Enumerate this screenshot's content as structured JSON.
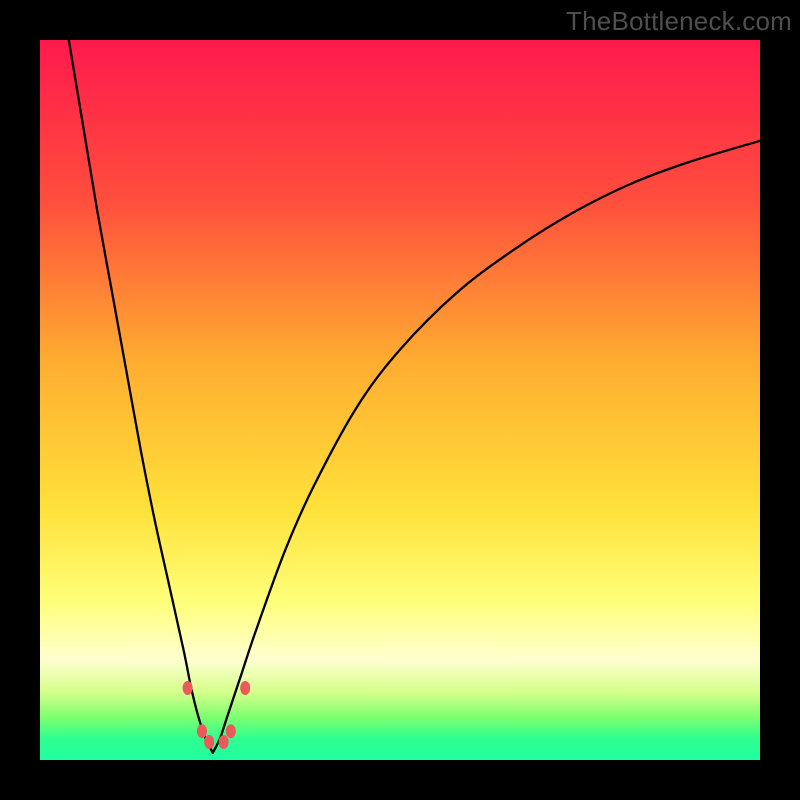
{
  "watermark": "TheBottleneck.com",
  "chart_data": {
    "type": "line",
    "title": "",
    "xlabel": "",
    "ylabel": "",
    "xlim": [
      0,
      100
    ],
    "ylim": [
      0,
      100
    ],
    "notch_x": 24,
    "background_gradient": [
      {
        "stop": 0.0,
        "color": "#ff1a4d"
      },
      {
        "stop": 0.22,
        "color": "#ff4d3d"
      },
      {
        "stop": 0.45,
        "color": "#ffae30"
      },
      {
        "stop": 0.65,
        "color": "#ffe13a"
      },
      {
        "stop": 0.78,
        "color": "#ffff7a"
      },
      {
        "stop": 0.86,
        "color": "#ffffd0"
      },
      {
        "stop": 0.905,
        "color": "#d6ff8c"
      },
      {
        "stop": 0.94,
        "color": "#7fff70"
      },
      {
        "stop": 0.97,
        "color": "#2fff8f"
      },
      {
        "stop": 1.0,
        "color": "#1fffa2"
      }
    ],
    "series": [
      {
        "name": "curve-left",
        "x": [
          4,
          6,
          8,
          10,
          12,
          14,
          16,
          18,
          20,
          21,
          22,
          23,
          24
        ],
        "y": [
          100,
          88,
          76,
          65,
          54,
          43,
          33,
          24,
          15,
          10,
          6,
          3,
          1
        ]
      },
      {
        "name": "curve-right",
        "x": [
          24,
          25,
          26,
          28,
          30,
          34,
          38,
          44,
          50,
          58,
          66,
          74,
          82,
          90,
          100
        ],
        "y": [
          1,
          3,
          6,
          12,
          18,
          29,
          38,
          49,
          57,
          65,
          71,
          76,
          80,
          83,
          86
        ]
      }
    ],
    "markers": [
      {
        "x": 20.5,
        "y": 10
      },
      {
        "x": 22.5,
        "y": 4
      },
      {
        "x": 23.5,
        "y": 2.5
      },
      {
        "x": 25.5,
        "y": 2.5
      },
      {
        "x": 26.5,
        "y": 4
      },
      {
        "x": 28.5,
        "y": 10
      }
    ],
    "marker_style": {
      "fill": "#ea5a5a",
      "rx": 5,
      "ry": 7
    },
    "curve_stroke": "#000000",
    "curve_width": 2.3
  }
}
